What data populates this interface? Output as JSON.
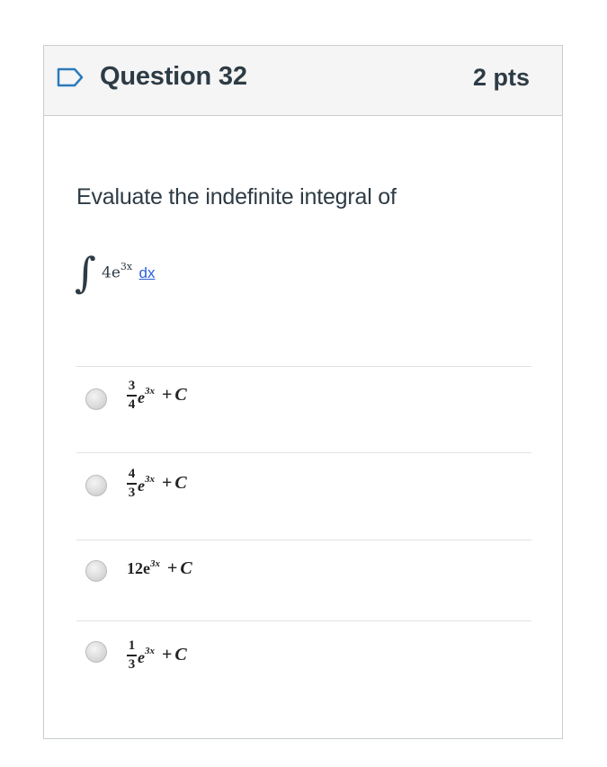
{
  "question": {
    "title": "Question 32",
    "points": "2 pts",
    "prompt": "Evaluate the indefinite integral of",
    "integrand": {
      "integral_sign": "∫",
      "coefficient": "4e",
      "exponent": "3x",
      "differential": "dx"
    }
  },
  "answers": [
    {
      "numerator": "3",
      "denominator": "4",
      "base": "e",
      "exponent": "3x",
      "plus": "+",
      "constant": "C",
      "selected": false
    },
    {
      "numerator": "4",
      "denominator": "3",
      "base": "e",
      "exponent": "3x",
      "plus": "+",
      "constant": "C",
      "selected": false
    },
    {
      "coefficient": "12e",
      "exponent": "3x",
      "plus": "+",
      "constant": "C",
      "selected": false
    },
    {
      "numerator": "1",
      "denominator": "3",
      "base": "e",
      "exponent": "3x",
      "plus": "+",
      "constant": "C",
      "selected": false
    }
  ],
  "colors": {
    "header_bg": "#f5f5f5",
    "border": "#c7cdd1",
    "text": "#2d3b45",
    "link": "#2b5fd9",
    "flag_icon": "#2b7abc"
  },
  "icons": {
    "flag": "bookmark-flag-icon"
  }
}
